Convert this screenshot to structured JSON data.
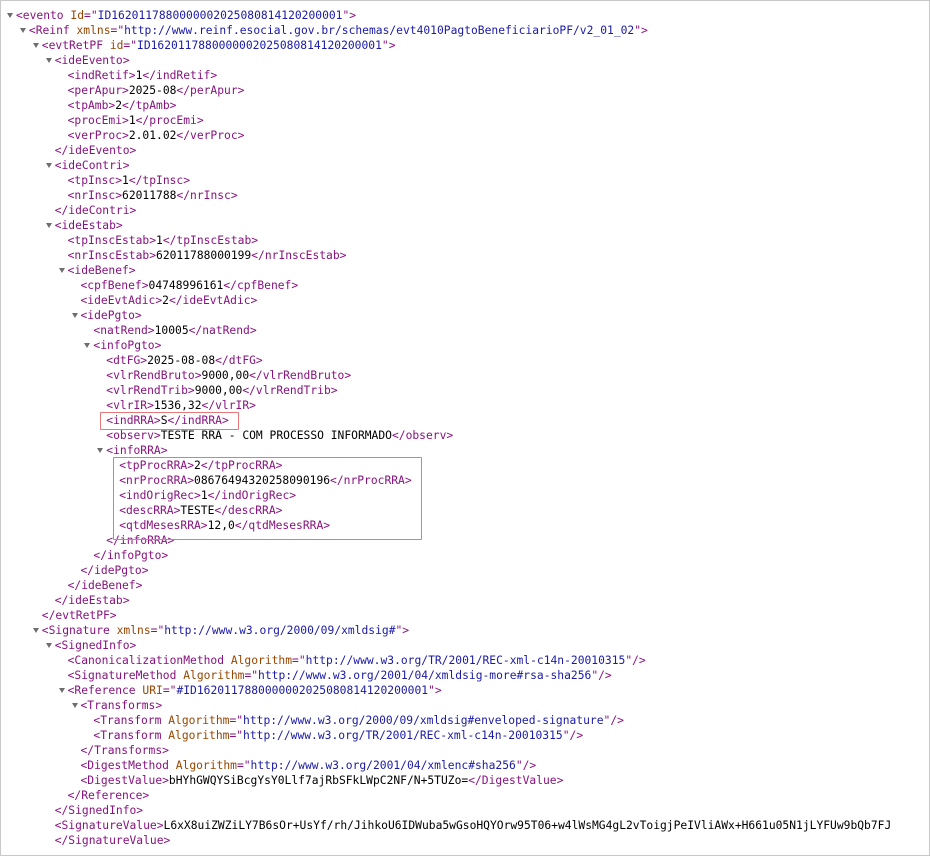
{
  "colors": {
    "tag": "#881280",
    "attribute": "#994500",
    "value": "#1a1aa6",
    "highlight": "#e8777a"
  },
  "highlight_boxes": [
    {
      "name": "highlight-indRRA",
      "first_line": 27,
      "last_line": 27
    },
    {
      "name": "highlight-infoRRA-children",
      "first_line": 30,
      "last_line": 34
    }
  ],
  "lines": [
    {
      "d": 0,
      "t": 1,
      "s": [
        [
          "tag",
          "<evento "
        ],
        [
          "attr",
          "Id"
        ],
        [
          "tag",
          "=\""
        ],
        [
          "val",
          "ID1620117880000002025080814120200001"
        ],
        [
          "tag",
          "\">"
        ]
      ]
    },
    {
      "d": 1,
      "t": 1,
      "s": [
        [
          "tag",
          "<Reinf "
        ],
        [
          "attr",
          "xmlns"
        ],
        [
          "tag",
          "=\""
        ],
        [
          "val",
          "http://www.reinf.esocial.gov.br/schemas/evt4010PagtoBeneficiarioPF/v2_01_02"
        ],
        [
          "tag",
          "\">"
        ]
      ]
    },
    {
      "d": 2,
      "t": 1,
      "s": [
        [
          "tag",
          "<evtRetPF "
        ],
        [
          "attr",
          "id"
        ],
        [
          "tag",
          "=\""
        ],
        [
          "val",
          "ID1620117880000002025080814120200001"
        ],
        [
          "tag",
          "\">"
        ]
      ]
    },
    {
      "d": 3,
      "t": 1,
      "s": [
        [
          "tag",
          "<ideEvento>"
        ]
      ]
    },
    {
      "d": 4,
      "t": 0,
      "s": [
        [
          "tag",
          "<indRetif>"
        ],
        [
          "txt",
          "1"
        ],
        [
          "tag",
          "</indRetif>"
        ]
      ]
    },
    {
      "d": 4,
      "t": 0,
      "s": [
        [
          "tag",
          "<perApur>"
        ],
        [
          "txt",
          "2025-08"
        ],
        [
          "tag",
          "</perApur>"
        ]
      ]
    },
    {
      "d": 4,
      "t": 0,
      "s": [
        [
          "tag",
          "<tpAmb>"
        ],
        [
          "txt",
          "2"
        ],
        [
          "tag",
          "</tpAmb>"
        ]
      ]
    },
    {
      "d": 4,
      "t": 0,
      "s": [
        [
          "tag",
          "<procEmi>"
        ],
        [
          "txt",
          "1"
        ],
        [
          "tag",
          "</procEmi>"
        ]
      ]
    },
    {
      "d": 4,
      "t": 0,
      "s": [
        [
          "tag",
          "<verProc>"
        ],
        [
          "txt",
          "2.01.02"
        ],
        [
          "tag",
          "</verProc>"
        ]
      ]
    },
    {
      "d": 3,
      "t": 0,
      "s": [
        [
          "tag",
          "</ideEvento>"
        ]
      ]
    },
    {
      "d": 3,
      "t": 1,
      "s": [
        [
          "tag",
          "<ideContri>"
        ]
      ]
    },
    {
      "d": 4,
      "t": 0,
      "s": [
        [
          "tag",
          "<tpInsc>"
        ],
        [
          "txt",
          "1"
        ],
        [
          "tag",
          "</tpInsc>"
        ]
      ]
    },
    {
      "d": 4,
      "t": 0,
      "s": [
        [
          "tag",
          "<nrInsc>"
        ],
        [
          "txt",
          "62011788"
        ],
        [
          "tag",
          "</nrInsc>"
        ]
      ]
    },
    {
      "d": 3,
      "t": 0,
      "s": [
        [
          "tag",
          "</ideContri>"
        ]
      ]
    },
    {
      "d": 3,
      "t": 1,
      "s": [
        [
          "tag",
          "<ideEstab>"
        ]
      ]
    },
    {
      "d": 4,
      "t": 0,
      "s": [
        [
          "tag",
          "<tpInscEstab>"
        ],
        [
          "txt",
          "1"
        ],
        [
          "tag",
          "</tpInscEstab>"
        ]
      ]
    },
    {
      "d": 4,
      "t": 0,
      "s": [
        [
          "tag",
          "<nrInscEstab>"
        ],
        [
          "txt",
          "62011788000199"
        ],
        [
          "tag",
          "</nrInscEstab>"
        ]
      ]
    },
    {
      "d": 4,
      "t": 1,
      "s": [
        [
          "tag",
          "<ideBenef>"
        ]
      ]
    },
    {
      "d": 5,
      "t": 0,
      "s": [
        [
          "tag",
          "<cpfBenef>"
        ],
        [
          "txt",
          "04748996161"
        ],
        [
          "tag",
          "</cpfBenef>"
        ]
      ]
    },
    {
      "d": 5,
      "t": 0,
      "s": [
        [
          "tag",
          "<ideEvtAdic>"
        ],
        [
          "txt",
          "2"
        ],
        [
          "tag",
          "</ideEvtAdic>"
        ]
      ]
    },
    {
      "d": 5,
      "t": 1,
      "s": [
        [
          "tag",
          "<idePgto>"
        ]
      ]
    },
    {
      "d": 6,
      "t": 0,
      "s": [
        [
          "tag",
          "<natRend>"
        ],
        [
          "txt",
          "10005"
        ],
        [
          "tag",
          "</natRend>"
        ]
      ]
    },
    {
      "d": 6,
      "t": 1,
      "s": [
        [
          "tag",
          "<infoPgto>"
        ]
      ]
    },
    {
      "d": 7,
      "t": 0,
      "s": [
        [
          "tag",
          "<dtFG>"
        ],
        [
          "txt",
          "2025-08-08"
        ],
        [
          "tag",
          "</dtFG>"
        ]
      ]
    },
    {
      "d": 7,
      "t": 0,
      "s": [
        [
          "tag",
          "<vlrRendBruto>"
        ],
        [
          "txt",
          "9000,00"
        ],
        [
          "tag",
          "</vlrRendBruto>"
        ]
      ]
    },
    {
      "d": 7,
      "t": 0,
      "s": [
        [
          "tag",
          "<vlrRendTrib>"
        ],
        [
          "txt",
          "9000,00"
        ],
        [
          "tag",
          "</vlrRendTrib>"
        ]
      ]
    },
    {
      "d": 7,
      "t": 0,
      "s": [
        [
          "tag",
          "<vlrIR>"
        ],
        [
          "txt",
          "1536,32"
        ],
        [
          "tag",
          "</vlrIR>"
        ]
      ]
    },
    {
      "d": 7,
      "t": 0,
      "s": [
        [
          "tag",
          "<indRRA>"
        ],
        [
          "txt",
          "S"
        ],
        [
          "tag",
          "</indRRA>"
        ]
      ]
    },
    {
      "d": 7,
      "t": 0,
      "s": [
        [
          "tag",
          "<observ>"
        ],
        [
          "txt",
          "TESTE RRA - COM PROCESSO INFORMADO"
        ],
        [
          "tag",
          "</observ>"
        ]
      ]
    },
    {
      "d": 7,
      "t": 1,
      "s": [
        [
          "tag",
          "<infoRRA>"
        ]
      ]
    },
    {
      "d": 8,
      "t": 0,
      "s": [
        [
          "tag",
          "<tpProcRRA>"
        ],
        [
          "txt",
          "2"
        ],
        [
          "tag",
          "</tpProcRRA>"
        ]
      ]
    },
    {
      "d": 8,
      "t": 0,
      "s": [
        [
          "tag",
          "<nrProcRRA>"
        ],
        [
          "txt",
          "08676494320258090196"
        ],
        [
          "tag",
          "</nrProcRRA>"
        ]
      ]
    },
    {
      "d": 8,
      "t": 0,
      "s": [
        [
          "tag",
          "<indOrigRec>"
        ],
        [
          "txt",
          "1"
        ],
        [
          "tag",
          "</indOrigRec>"
        ]
      ]
    },
    {
      "d": 8,
      "t": 0,
      "s": [
        [
          "tag",
          "<descRRA>"
        ],
        [
          "txt",
          "TESTE"
        ],
        [
          "tag",
          "</descRRA>"
        ]
      ]
    },
    {
      "d": 8,
      "t": 0,
      "s": [
        [
          "tag",
          "<qtdMesesRRA>"
        ],
        [
          "txt",
          "12,0"
        ],
        [
          "tag",
          "</qtdMesesRRA>"
        ]
      ]
    },
    {
      "d": 7,
      "t": 0,
      "s": [
        [
          "tag",
          "</infoRRA>"
        ]
      ]
    },
    {
      "d": 6,
      "t": 0,
      "s": [
        [
          "tag",
          "</infoPgto>"
        ]
      ]
    },
    {
      "d": 5,
      "t": 0,
      "s": [
        [
          "tag",
          "</idePgto>"
        ]
      ]
    },
    {
      "d": 4,
      "t": 0,
      "s": [
        [
          "tag",
          "</ideBenef>"
        ]
      ]
    },
    {
      "d": 3,
      "t": 0,
      "s": [
        [
          "tag",
          "</ideEstab>"
        ]
      ]
    },
    {
      "d": 2,
      "t": 0,
      "s": [
        [
          "tag",
          "</evtRetPF>"
        ]
      ]
    },
    {
      "d": 2,
      "t": 1,
      "s": [
        [
          "tag",
          "<Signature "
        ],
        [
          "attr",
          "xmlns"
        ],
        [
          "tag",
          "=\""
        ],
        [
          "val",
          "http://www.w3.org/2000/09/xmldsig#"
        ],
        [
          "tag",
          "\">"
        ]
      ]
    },
    {
      "d": 3,
      "t": 1,
      "s": [
        [
          "tag",
          "<SignedInfo>"
        ]
      ]
    },
    {
      "d": 4,
      "t": 0,
      "s": [
        [
          "tag",
          "<CanonicalizationMethod "
        ],
        [
          "attr",
          "Algorithm"
        ],
        [
          "tag",
          "=\""
        ],
        [
          "val",
          "http://www.w3.org/TR/2001/REC-xml-c14n-20010315"
        ],
        [
          "tag",
          "\"/>"
        ]
      ]
    },
    {
      "d": 4,
      "t": 0,
      "s": [
        [
          "tag",
          "<SignatureMethod "
        ],
        [
          "attr",
          "Algorithm"
        ],
        [
          "tag",
          "=\""
        ],
        [
          "val",
          "http://www.w3.org/2001/04/xmldsig-more#rsa-sha256"
        ],
        [
          "tag",
          "\"/>"
        ]
      ]
    },
    {
      "d": 4,
      "t": 1,
      "s": [
        [
          "tag",
          "<Reference "
        ],
        [
          "attr",
          "URI"
        ],
        [
          "tag",
          "=\""
        ],
        [
          "val",
          "#ID1620117880000002025080814120200001"
        ],
        [
          "tag",
          "\">"
        ]
      ]
    },
    {
      "d": 5,
      "t": 1,
      "s": [
        [
          "tag",
          "<Transforms>"
        ]
      ]
    },
    {
      "d": 6,
      "t": 0,
      "s": [
        [
          "tag",
          "<Transform "
        ],
        [
          "attr",
          "Algorithm"
        ],
        [
          "tag",
          "=\""
        ],
        [
          "val",
          "http://www.w3.org/2000/09/xmldsig#enveloped-signature"
        ],
        [
          "tag",
          "\"/>"
        ]
      ]
    },
    {
      "d": 6,
      "t": 0,
      "s": [
        [
          "tag",
          "<Transform "
        ],
        [
          "attr",
          "Algorithm"
        ],
        [
          "tag",
          "=\""
        ],
        [
          "val",
          "http://www.w3.org/TR/2001/REC-xml-c14n-20010315"
        ],
        [
          "tag",
          "\"/>"
        ]
      ]
    },
    {
      "d": 5,
      "t": 0,
      "s": [
        [
          "tag",
          "</Transforms>"
        ]
      ]
    },
    {
      "d": 5,
      "t": 0,
      "s": [
        [
          "tag",
          "<DigestMethod "
        ],
        [
          "attr",
          "Algorithm"
        ],
        [
          "tag",
          "=\""
        ],
        [
          "val",
          "http://www.w3.org/2001/04/xmlenc#sha256"
        ],
        [
          "tag",
          "\"/>"
        ]
      ]
    },
    {
      "d": 5,
      "t": 0,
      "s": [
        [
          "tag",
          "<DigestValue>"
        ],
        [
          "txt",
          "bHYhGWQYSiBcgYsY0Llf7ajRbSFkLWpC2NF/N+5TUZo="
        ],
        [
          "tag",
          "</DigestValue>"
        ]
      ]
    },
    {
      "d": 4,
      "t": 0,
      "s": [
        [
          "tag",
          "</Reference>"
        ]
      ]
    },
    {
      "d": 3,
      "t": 0,
      "s": [
        [
          "tag",
          "</SignedInfo>"
        ]
      ]
    },
    {
      "d": 3,
      "t": 0,
      "s": [
        [
          "tag",
          "<SignatureValue>"
        ],
        [
          "txt",
          "L6xX8uiZWZiLY7B6sOr+UsYf/rh/JihkoU6IDWuba5wGsoHQYOrw95T06+w4lWsMG4gL2vToigjPeIVliAWx+H661u05N1jLYFUw9bQb7FJ"
        ]
      ]
    },
    {
      "d": 3,
      "t": 0,
      "s": [
        [
          "tag",
          "</SignatureValue>"
        ]
      ]
    }
  ]
}
